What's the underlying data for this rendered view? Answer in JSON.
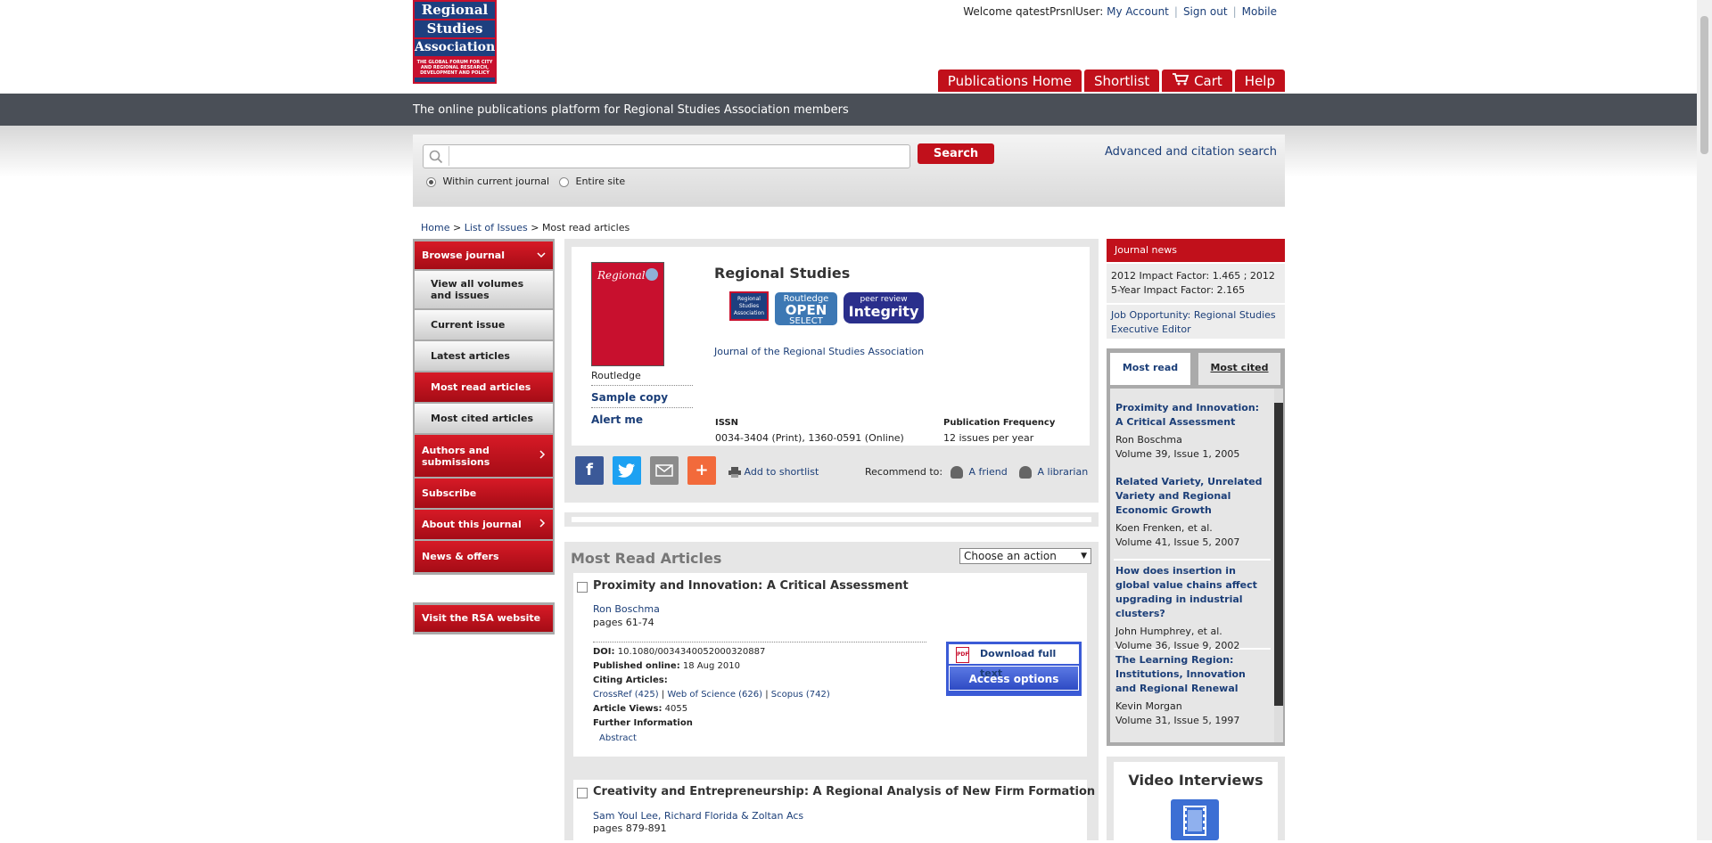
{
  "logo": {
    "line1": "Regional",
    "line2": "Studies",
    "line3": "Association",
    "tagline": "THE GLOBAL FORUM FOR CITY AND REGIONAL RESEARCH, DEVELOPMENT AND POLICY"
  },
  "toplinks": {
    "welcome": "Welcome qatestPrsnlUser:",
    "my_account": "My Account",
    "sign_out": "Sign out",
    "mobile": "Mobile"
  },
  "nav": {
    "publications_home": "Publications Home",
    "shortlist": "Shortlist",
    "cart": "Cart",
    "help": "Help"
  },
  "tagline": "The online publications platform for Regional Studies Association members",
  "search": {
    "placeholder": "",
    "button": "Search",
    "advanced": "Advanced and citation search",
    "opt_current": "Within current journal",
    "opt_site": "Entire site"
  },
  "breadcrumb": {
    "home": "Home",
    "list": "List of Issues",
    "current": "Most read articles",
    "sep": ">"
  },
  "leftnav": {
    "browse": "Browse journal",
    "view_all": "View all volumes and issues",
    "current": "Current issue",
    "latest": "Latest articles",
    "most_read": "Most read articles",
    "most_cited": "Most cited articles",
    "authors": "Authors and submissions",
    "subscribe": "Subscribe",
    "about": "About this journal",
    "news": "News & offers",
    "rsa": "Visit the RSA website"
  },
  "journal": {
    "cover_title": "Regional",
    "title": "Regional Studies",
    "badge1": "Regional Studies Association",
    "badge2_top": "Routledge",
    "badge2_mid": "OPEN",
    "badge2_bot": "SELECT",
    "badge3_top": "peer review",
    "badge3_mid": "Integrity",
    "subtitle": "Journal of the Regional Studies Association",
    "publisher": "Routledge",
    "sample": "Sample copy",
    "alert": "Alert me",
    "issn_label": "ISSN",
    "issn_value": "0034-3404 (Print), 1360-0591 (Online)",
    "freq_label": "Publication Frequency",
    "freq_value": "12 issues per year"
  },
  "share": {
    "add_shortlist": "Add to shortlist",
    "recommend": "Recommend to:",
    "friend": "A friend",
    "librarian": "A librarian"
  },
  "most_read": {
    "title": "Most Read Articles",
    "action": "Choose an action",
    "a1": {
      "title": "Proximity and Innovation: A Critical Assessment",
      "authors": "Ron Boschma",
      "pages": "pages 61-74",
      "doi_label": "DOI:",
      "doi": "10.1080/0034340052000320887",
      "pub_label": "Published online:",
      "pub": "18 Aug 2010",
      "citing_label": "Citing Articles:",
      "crossref": "CrossRef (425)",
      "wos": "Web of Science (626)",
      "scopus": "Scopus (742)",
      "views_label": "Article Views:",
      "views": "4055",
      "further": "Further Information",
      "abstract": "Abstract",
      "download": "Download full text",
      "access": "Access options"
    },
    "a2": {
      "title": "Creativity and Entrepreneurship: A Regional Analysis of New Firm Formation",
      "authors": "Sam Youl Lee, Richard Florida & Zoltan Acs",
      "pages": "pages 879-891"
    }
  },
  "right": {
    "news_head": "Journal news",
    "impact1": "2012 Impact Factor: 1.465 ; 2012",
    "impact2": "5-Year Impact Factor: 2.165",
    "job": "Job Opportunity: Regional Studies Executive Editor",
    "tab_read": "Most read",
    "tab_cited": "Most cited",
    "items": [
      {
        "title": "Proximity and Innovation: A Critical Assessment",
        "author": "Ron Boschma",
        "vol": "Volume 39, Issue 1, 2005"
      },
      {
        "title": "Related Variety, Unrelated Variety and Regional Economic Growth",
        "author": "Koen Frenken, et al.",
        "vol": "Volume 41, Issue 5, 2007"
      },
      {
        "title": "How does insertion in global value chains affect upgrading in industrial clusters?",
        "author": "John Humphrey, et al.",
        "vol": "Volume 36, Issue 9, 2002"
      },
      {
        "title": "The Learning Region: Institutions, Innovation and Regional Renewal",
        "author": "Kevin Morgan",
        "vol": "Volume 31, Issue 5, 1997"
      }
    ],
    "video": "Video Interviews"
  },
  "colors": {
    "brand_red": "#c1101b",
    "brand_blue": "#1d3f7f",
    "link": "#1b3e78"
  },
  "icons": [
    "search-icon",
    "cart-icon",
    "facebook-icon",
    "twitter-icon",
    "email-icon",
    "addthis-plus-icon",
    "printer-icon",
    "person-icon",
    "pdf-icon",
    "video-icon",
    "chevron-down-icon",
    "chevron-right-icon"
  ]
}
